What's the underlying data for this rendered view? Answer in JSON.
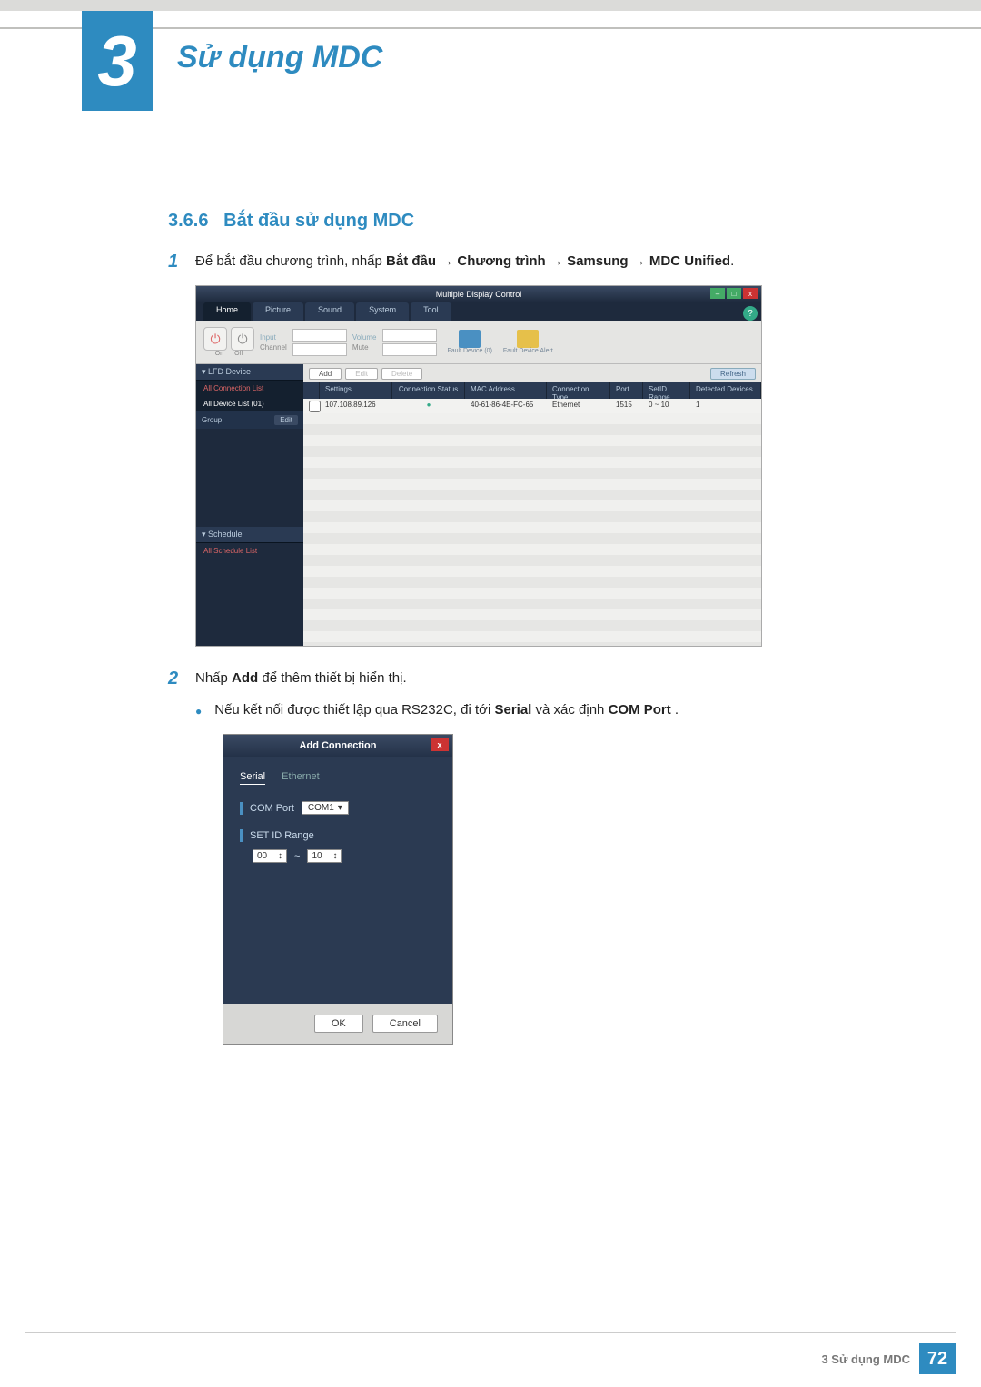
{
  "header": {
    "chapter_num": "3",
    "chapter_title": "Sử dụng MDC"
  },
  "section": {
    "number": "3.6.6",
    "title": "Bắt đầu sử dụng MDC"
  },
  "step1": {
    "num": "1",
    "t1": "Để bắt đầu chương trình, nhấp ",
    "b1": "Bắt đầu",
    "a1": " → ",
    "b2": "Chương trình",
    "a2": " → ",
    "b3": "Samsung",
    "a3": " → ",
    "b4": "MDC Unified",
    "a4": "."
  },
  "shot1": {
    "title": "Multiple Display Control",
    "help": "?",
    "win_min": "–",
    "win_max": "□",
    "win_close": "x",
    "tabs": [
      "Home",
      "Picture",
      "Sound",
      "System",
      "Tool"
    ],
    "on": "On",
    "off": "Off",
    "input_lbl": "Input",
    "channel_lbl": "Channel",
    "volume_lbl": "Volume",
    "mute_lbl": "Mute",
    "fault0": "Fault Device (0)",
    "fault_alert": "Fault Device Alert",
    "side_lfd": "▾ LFD Device",
    "side_allconn": "All Connection List",
    "side_alldev": "All Device List (01)",
    "side_group": "Group",
    "side_edit": "Edit",
    "side_sched": "▾ Schedule",
    "side_allsched": "All Schedule List",
    "btn_add": "Add",
    "btn_edit": "Edit",
    "btn_del": "Delete",
    "btn_refresh": "Refresh",
    "th_settings": "Settings",
    "th_conn": "Connection Status",
    "th_mac": "MAC Address",
    "th_type": "Connection Type",
    "th_port": "Port",
    "th_range": "SetID Range",
    "th_det": "Detected Devices",
    "row": {
      "ip": "107.108.89.126",
      "status": "●",
      "mac": "40-61-86-4E-FC-65",
      "type": "Ethernet",
      "port": "1515",
      "range": "0 ~ 10",
      "det": "1"
    }
  },
  "step2": {
    "num": "2",
    "t1": "Nhấp ",
    "b1": "Add",
    "t2": " để thêm thiết bị hiển thị.",
    "bullet_t1": "Nếu kết nối được thiết lập qua RS232C, đi tới ",
    "bullet_b1": "Serial",
    "bullet_t2": " và xác định ",
    "bullet_b2": "COM Port",
    "bullet_t3": "."
  },
  "shot2": {
    "title": "Add Connection",
    "close": "x",
    "tab_serial": "Serial",
    "tab_eth": "Ethernet",
    "lbl_comport": "COM Port",
    "sel_com": "COM1",
    "caret": "▾",
    "lbl_range": "SET ID Range",
    "spin_from": "00",
    "spin_sep": "~",
    "spin_to": "10",
    "spin_caret": "↕",
    "btn_ok": "OK",
    "btn_cancel": "Cancel"
  },
  "footer": {
    "text": "3 Sử dụng MDC",
    "page": "72"
  }
}
